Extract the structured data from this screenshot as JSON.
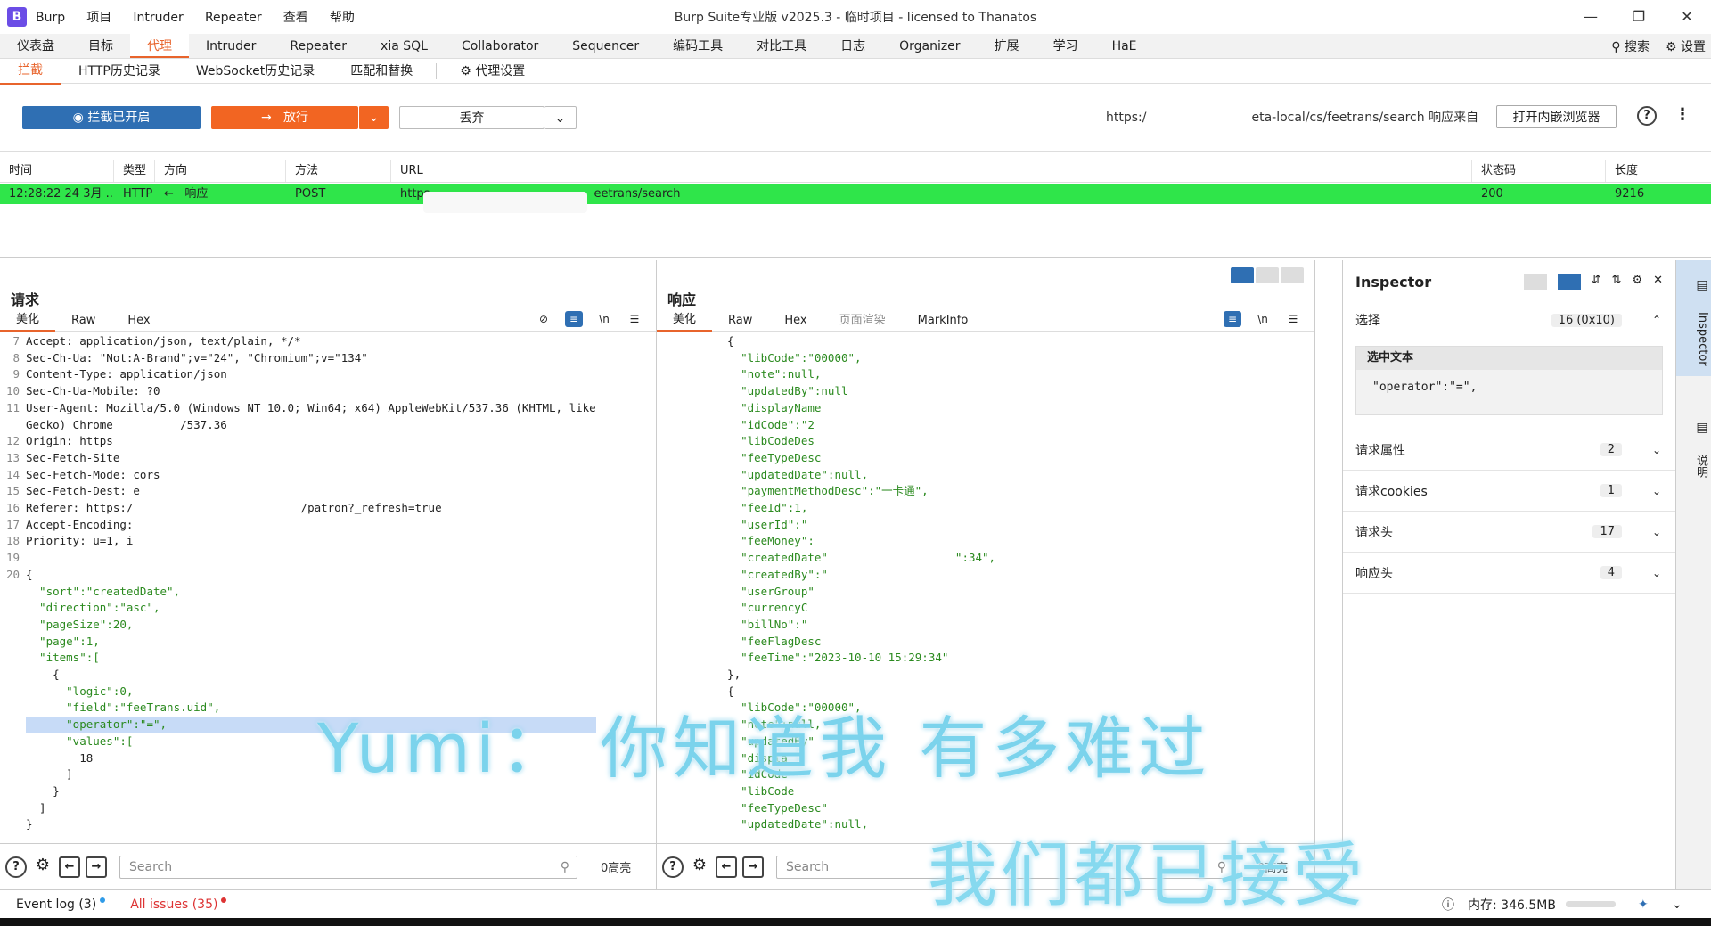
{
  "app": {
    "logo": "B",
    "window_title": "Burp Suite专业版  v2025.3 - 临时项目 - licensed to Thanatos",
    "menu": [
      "Burp",
      "项目",
      "Intruder",
      "Repeater",
      "查看",
      "帮助"
    ]
  },
  "main_tabs": [
    "仪表盘",
    "目标",
    "代理",
    "Intruder",
    "Repeater",
    "xia SQL",
    "Collaborator",
    "Sequencer",
    "编码工具",
    "对比工具",
    "日志",
    "Organizer",
    "扩展",
    "学习",
    "HaE"
  ],
  "main_tab_active": "代理",
  "main_right": {
    "search": "搜索",
    "settings": "设置"
  },
  "proxy_tabs": [
    "拦截",
    "HTTP历史记录",
    "WebSocket历史记录",
    "匹配和替换"
  ],
  "proxy_settings": "代理设置",
  "toolbar": {
    "intercept_label": "拦截已开启",
    "forward_label": "放行",
    "drop_label": "丢弃",
    "url_prefix": "https:/",
    "url_suffix": "eta-local/cs/feetrans/search 响应来自",
    "open_browser": "打开内嵌浏览器"
  },
  "table": {
    "headers": [
      "时间",
      "类型",
      "方向",
      "方法",
      "URL",
      "状态码",
      "长度"
    ],
    "row": {
      "time": "12:28:22 24 3月 ...",
      "type": "HTTP",
      "dir_arrow": "←",
      "dir": "响应",
      "method": "POST",
      "url_start": "https",
      "url_end": "eetrans/search",
      "status": "200",
      "length": "9216"
    }
  },
  "request": {
    "title": "请求",
    "tabs": [
      "美化",
      "Raw",
      "Hex"
    ],
    "lines": [
      {
        "n": "7",
        "t": "Accept: application/json, text/plain, */*"
      },
      {
        "n": "8",
        "t": "Sec-Ch-Ua: \"Not:A-Brand\";v=\"24\", \"Chromium\";v=\"134\""
      },
      {
        "n": "9",
        "t": "Content-Type: application/json"
      },
      {
        "n": "10",
        "t": "Sec-Ch-Ua-Mobile: ?0"
      },
      {
        "n": "11",
        "t": "User-Agent: Mozilla/5.0 (Windows NT 10.0; Win64; x64) AppleWebKit/537.36 (KHTML, like"
      },
      {
        "n": "",
        "t": "Gecko) Chrome          /537.36"
      },
      {
        "n": "12",
        "t": "Origin: https"
      },
      {
        "n": "13",
        "t": "Sec-Fetch-Site"
      },
      {
        "n": "14",
        "t": "Sec-Fetch-Mode: cors"
      },
      {
        "n": "15",
        "t": "Sec-Fetch-Dest: e"
      },
      {
        "n": "16",
        "t": "Referer: https:/                         /patron?_refresh=true"
      },
      {
        "n": "17",
        "t": "Accept-Encoding:"
      },
      {
        "n": "18",
        "t": "Priority: u=1, i"
      },
      {
        "n": "19",
        "t": ""
      },
      {
        "n": "20",
        "t": "{"
      },
      {
        "n": "",
        "t": "  \"sort\":\"createdDate\","
      },
      {
        "n": "",
        "t": "  \"direction\":\"asc\","
      },
      {
        "n": "",
        "t": "  \"pageSize\":20,"
      },
      {
        "n": "",
        "t": "  \"page\":1,"
      },
      {
        "n": "",
        "t": "  \"items\":["
      },
      {
        "n": "",
        "t": "    {"
      },
      {
        "n": "",
        "t": "      \"logic\":0,"
      },
      {
        "n": "",
        "t": "      \"field\":\"feeTrans.uid\","
      },
      {
        "n": "",
        "t": "      \"operator\":\"=\","
      },
      {
        "n": "",
        "t": "      \"values\":["
      },
      {
        "n": "",
        "t": "        18"
      },
      {
        "n": "",
        "t": "      ]"
      },
      {
        "n": "",
        "t": "    }"
      },
      {
        "n": "",
        "t": "  ]"
      },
      {
        "n": "",
        "t": "}"
      }
    ]
  },
  "response": {
    "title": "响应",
    "tabs": [
      "美化",
      "Raw",
      "Hex",
      "页面渲染",
      "MarkInfo"
    ],
    "lines": [
      "  {",
      "    \"libCode\":\"00000\",",
      "    \"note\":null,",
      "    \"updatedBy\":null",
      "    \"displayName",
      "    \"idCode\":\"2",
      "    \"libCodeDes",
      "    \"feeTypeDesc",
      "    \"updatedDate\":null,",
      "    \"paymentMethodDesc\":\"一卡通\",",
      "    \"feeId\":1,",
      "    \"userId\":\"",
      "    \"feeMoney\":",
      "    \"createdDate\"                   \":34\",",
      "    \"createdBy\":\"",
      "    \"userGroup\"",
      "    \"currencyC",
      "    \"billNo\":\"",
      "    \"feeFlagDesc",
      "    \"feeTime\":\"2023-10-10 15:29:34\"",
      "  },",
      "  {",
      "    \"libCode\":\"00000\",",
      "    \"note\":null,",
      "    \"updatedBy\"",
      "    \"displa",
      "    \"idCode",
      "    \"libCode",
      "    \"feeTypeDesc\"",
      "    \"updatedDate\":null,"
    ]
  },
  "bottom": {
    "search_placeholder": "Search",
    "highlights": "0高亮"
  },
  "inspector": {
    "title": "Inspector",
    "selection_label": "选择",
    "selection_count": "16 (0x10)",
    "selected_text_label": "选中文本",
    "selected_text": "\"operator\":\"=\",",
    "sections": [
      {
        "label": "请求属性",
        "count": "2"
      },
      {
        "label": "请求cookies",
        "count": "1"
      },
      {
        "label": "请求头",
        "count": "17"
      },
      {
        "label": "响应头",
        "count": "4"
      }
    ]
  },
  "sidebar": {
    "inspector": "Inspector",
    "notes": "说明"
  },
  "status": {
    "event_log": "Event log (3)",
    "issues": "All issues (35)",
    "memory": "内存: 346.5MB"
  },
  "overlay": {
    "line1": "Yumi： 你知道我    有多难过",
    "line2": "我们都已接受"
  },
  "colors": {
    "accent": "#e8642c",
    "row_highlight": "#2fe54a",
    "intercept_blue": "#2f6fb3",
    "forward_orange": "#f26522"
  }
}
